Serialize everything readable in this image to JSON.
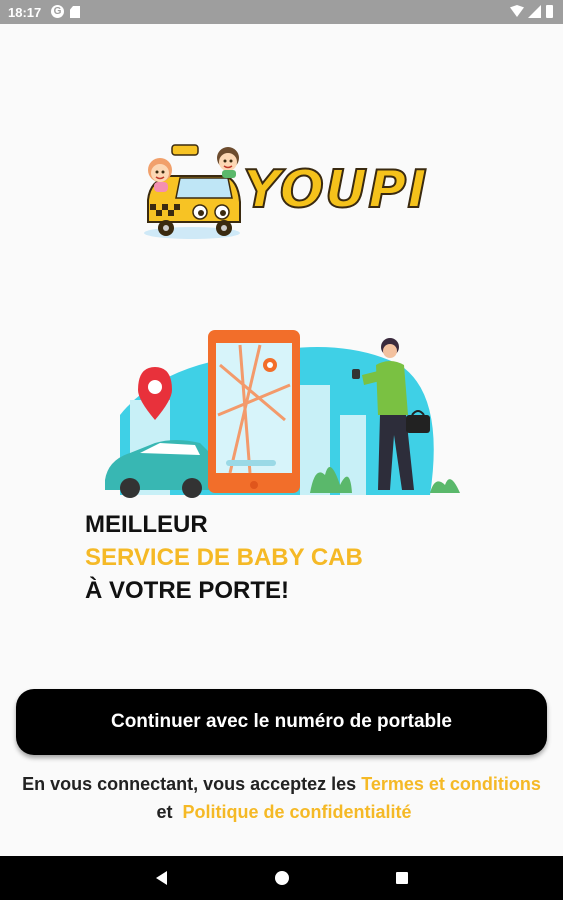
{
  "status_bar": {
    "time": "18:17",
    "icons": [
      "google-notification-icon",
      "sd-card-icon",
      "wifi-icon",
      "signal-icon",
      "battery-icon"
    ]
  },
  "logo": {
    "text": "YOUPI",
    "icon": "kids-taxi-logo"
  },
  "hero": {
    "icon": "phone-map-taxi-illustration"
  },
  "tagline": {
    "line1": "MEILLEUR",
    "line2": "SERVICE DE BABY CAB",
    "line3": "À VOTRE PORTE!"
  },
  "continue_button": {
    "label": "Continuer avec le numéro de portable"
  },
  "legal": {
    "prefix": "En vous connectant, vous acceptez les",
    "terms_link": "Termes et conditions",
    "and": "et",
    "privacy_link": "Politique de confidentialité"
  },
  "colors": {
    "accent": "#f5b926",
    "button_bg": "#000000",
    "background": "#fafafa",
    "status_bar": "#9e9e9e"
  },
  "nav_bar": {
    "icons": [
      "back-icon",
      "home-icon",
      "recents-icon"
    ]
  }
}
